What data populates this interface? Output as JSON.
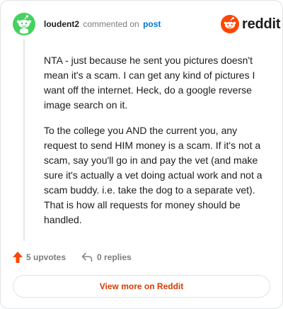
{
  "header": {
    "username": "loudent2",
    "action": "commented on",
    "target": "post",
    "brand_wordmark": "reddit"
  },
  "comment": {
    "paragraphs": [
      "NTA - just because he sent you pictures doesn't mean it's a scam. I can get any kind of pictures I want off the internet. Heck, do a google reverse image search on it.",
      "To the college you AND the current you, any request to send HIM money is a scam. If it's not a scam, say you'll go in and pay the vet (and make sure it's actually a vet doing actual work and not a scam buddy. i.e. take the dog to a separate vet). That is how all requests for money should be handled."
    ]
  },
  "footer": {
    "upvotes": "5 upvotes",
    "replies": "0 replies",
    "view_more": "View more on Reddit"
  },
  "icons": {
    "avatar": "snoo-avatar-icon",
    "brand": "reddit-logo-icon",
    "upvote": "upvote-arrow-icon",
    "reply": "reply-arrow-icon"
  },
  "colors": {
    "avatar_bg": "#46d160",
    "brand_orange": "#ff4500",
    "upvote_orange": "#ff4500",
    "link_blue": "#0079d3",
    "view_more_text": "#d93a00"
  }
}
